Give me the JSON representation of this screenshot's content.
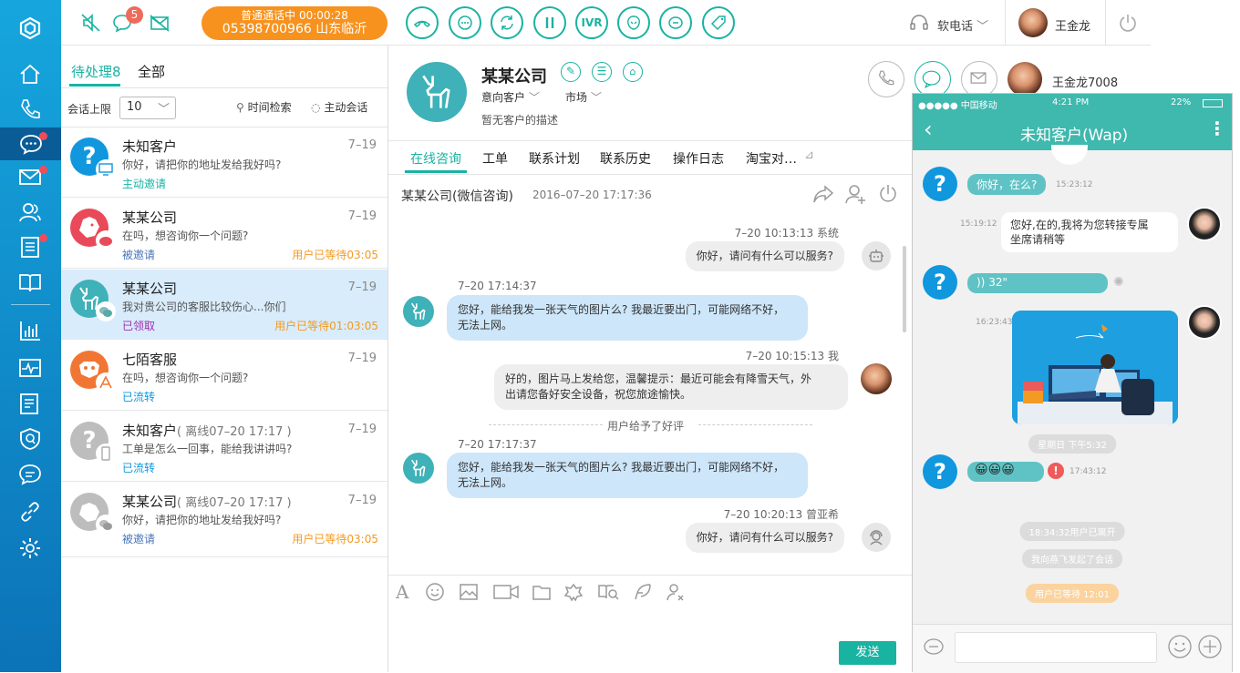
{
  "topbar": {
    "missed_count": "5",
    "call_status": "普通通话中 00:00:28",
    "call_number": "05398700966 山东临沂",
    "ivr": "IVR",
    "softphone": "软电话",
    "user_name": "王金龙"
  },
  "left": {
    "tab_pending": "待处理8",
    "tab_all": "全部",
    "limit_label": "会话上限",
    "limit_value": "10",
    "time_search": "时间检索",
    "active_chat": "主动会话",
    "items": [
      {
        "name": "未知客户",
        "sub": "",
        "date": "7–19",
        "msg": "你好，请把你的地址发给我好吗?",
        "status": "主动邀请",
        "wait": ""
      },
      {
        "name": "某某公司",
        "sub": "",
        "date": "7–19",
        "msg": "在吗，想咨询你一个问题?",
        "status": "被邀请",
        "wait": "用户已等待03:05"
      },
      {
        "name": "某某公司",
        "sub": "",
        "date": "7–19",
        "msg": "我对贵公司的客服比较伤心...你们",
        "status": "已领取",
        "wait": "用户已等待01:03:05"
      },
      {
        "name": "七陌客服",
        "sub": "",
        "date": "7–19",
        "msg": "在吗，想咨询你一个问题?",
        "status": "已流转",
        "wait": ""
      },
      {
        "name": "未知客户",
        "sub": "( 离线07–20 17:17 )",
        "date": "7–19",
        "msg": "工单是怎么一回事，能给我讲讲吗?",
        "status": "已流转",
        "wait": ""
      },
      {
        "name": "某某公司",
        "sub": "( 离线07–20 17:17 )",
        "date": "7–19",
        "msg": "你好，请把你的地址发给我好吗?",
        "status": "被邀请",
        "wait": "用户已等待03:05"
      }
    ]
  },
  "customer": {
    "name": "某某公司",
    "intent": "意向客户",
    "market": "市场",
    "desc": "暂无客户的描述",
    "agent": "王金龙7008"
  },
  "tabs": [
    "在线咨询",
    "工单",
    "联系计划",
    "联系历史",
    "操作日志",
    "淘宝对…"
  ],
  "chat": {
    "title": "某某公司(微信咨询)",
    "date": "2016–07–20 17:17:36",
    "m1_time": "7–20  10:13:13  系统",
    "m1": "你好，请问有什么可以服务?",
    "m2_time": "7–20  17:14:37",
    "m2a": "您好，能给我发一张天气的图片么? 我最近要出门，可能网络不好，",
    "m2b": "无法上网。",
    "m3_time": "7–20  10:15:13  我",
    "m3a": "好的，图片马上发给您，温馨提示：最近可能会有降雪天气，外",
    "m3b": "出请您备好安全设备，祝您旅途愉快。",
    "divider": "用户给予了好评",
    "m4_time": "7–20  17:17:37",
    "m4a": "您好，能给我发一张天气的图片么? 我最近要出门，可能网络不好，",
    "m4b": "无法上网。",
    "m5_time": "7–20  10:20:13  曾亚希",
    "m5": "你好，请问有什么可以服务?",
    "send": "发送"
  },
  "phone": {
    "carrier": "●●●●● 中国移动",
    "time": "4:21 PM",
    "battery": "22%",
    "title": "未知客户(Wap)",
    "p1": "你好，在么?",
    "p1t": "15:23:12",
    "p2t": "15:19:12",
    "p2a": "您好,在的,我将为您转接专属",
    "p2b": "坐席请稍等",
    "p3": "32\"",
    "p4t": "16:23:43",
    "s1": "星期日  下午5:32",
    "p5t": "17:43:12",
    "s2": "18:34:32用户已离开",
    "s3": "我向燕飞发起了会话",
    "s4": "用户已等待 12:01"
  }
}
